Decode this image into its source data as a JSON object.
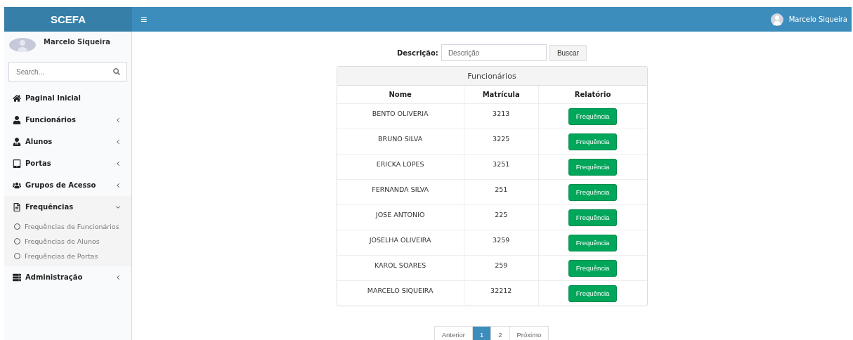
{
  "header": {
    "logo": "SCEFA",
    "menu_toggle": "≡",
    "user": "Marcelo Siqueira"
  },
  "sidebar": {
    "user": "Marcelo Siqueira",
    "search": {
      "placeholder": "Search..."
    },
    "items": [
      {
        "label": "Paginal Inicial",
        "has_caret": false
      },
      {
        "label": "Funcionários",
        "has_caret": true,
        "expanded": false
      },
      {
        "label": "Alunos",
        "has_caret": true,
        "expanded": false
      },
      {
        "label": "Portas",
        "has_caret": true,
        "expanded": false
      },
      {
        "label": "Grupos de Acesso",
        "has_caret": true,
        "expanded": false
      },
      {
        "label": "Frequências",
        "has_caret": true,
        "expanded": true,
        "children": [
          {
            "label": "Frequências de Funcionários"
          },
          {
            "label": "Frequências de Alunos"
          },
          {
            "label": "Frequências de Portas"
          }
        ]
      },
      {
        "label": "Administração",
        "has_caret": true,
        "expanded": false
      }
    ]
  },
  "filter": {
    "label": "Descrição:",
    "placeholder": "Descrição",
    "button": "Buscar"
  },
  "table": {
    "title": "Funcionários",
    "columns": [
      "Nome",
      "Matrícula",
      "Relatório"
    ],
    "rows": [
      {
        "name": "BENTO OLIVERIA",
        "id": "3213",
        "action": "Frequência"
      },
      {
        "name": "BRUNO SILVA",
        "id": "3225",
        "action": "Frequência"
      },
      {
        "name": "ERICKA LOPES",
        "id": "3251",
        "action": "Frequência"
      },
      {
        "name": "FERNANDA SILVA",
        "id": "251",
        "action": "Frequência"
      },
      {
        "name": "JOSE ANTONIO",
        "id": "225",
        "action": "Frequência"
      },
      {
        "name": "JOSELHA OLIVEIRA",
        "id": "3259",
        "action": "Frequência"
      },
      {
        "name": "KAROL SOARES",
        "id": "259",
        "action": "Frequência"
      },
      {
        "name": "MARCELO SIQUEIRA",
        "id": "32212",
        "action": "Frequência"
      }
    ]
  },
  "pagination": {
    "previous": "Anterior",
    "pages": [
      {
        "label": "1",
        "selected": true
      },
      {
        "label": "2",
        "selected": false
      }
    ],
    "next": "Próximo"
  }
}
